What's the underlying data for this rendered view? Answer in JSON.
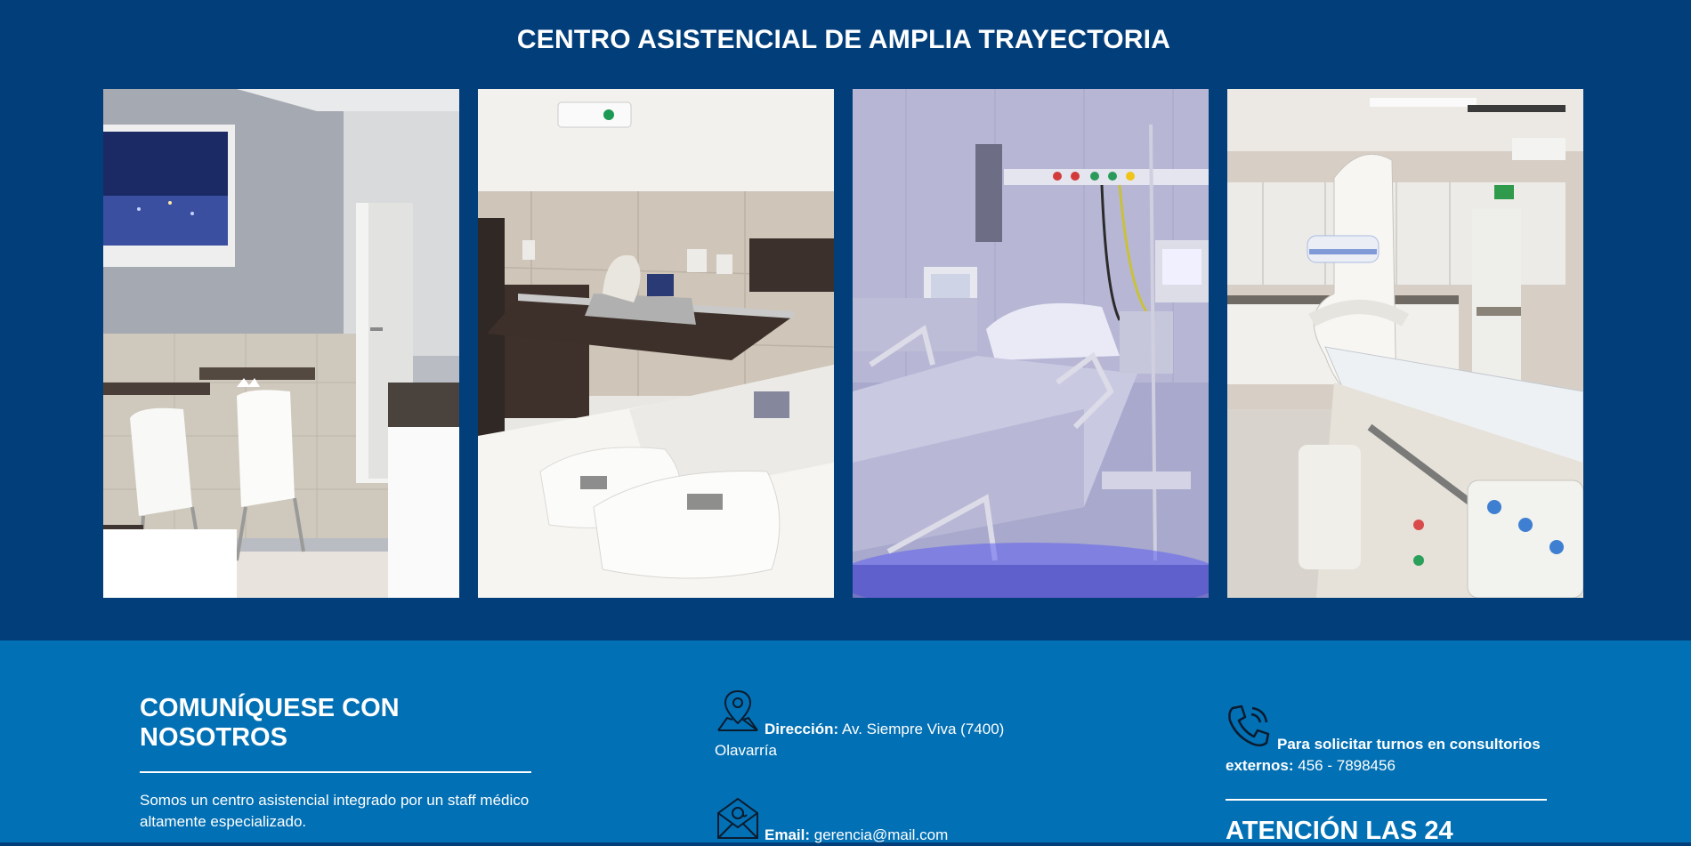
{
  "hero": {
    "title": "CENTRO ASISTENCIAL DE AMPLIA TRAYECTORIA",
    "photos": [
      {
        "icon": "patient-room-photo"
      },
      {
        "icon": "bed-towels-photo"
      },
      {
        "icon": "intensive-care-bed-photo"
      },
      {
        "icon": "angiography-room-photo"
      }
    ]
  },
  "contact": {
    "heading": "COMUNÍQUESE CON NOSOTROS",
    "description": "Somos un centro asistencial integrado por un staff médico altamente especializado.",
    "address": {
      "icon": "map-pin-icon",
      "label": "Dirección:",
      "value": "Av. Siempre Viva (7400) Olavarría"
    },
    "email": {
      "icon": "envelope-icon",
      "label": "Email:",
      "value": "gerencia@mail.com"
    },
    "phone": {
      "icon": "phone-icon",
      "label": "Para solicitar turnos en consultorios externos:",
      "value": "456 - 7898456"
    },
    "attention_heading": "ATENCIÓN LAS 24"
  },
  "colors": {
    "hero_bg": "#023e7a",
    "contact_bg": "#0270b4",
    "text": "#ffffff"
  }
}
